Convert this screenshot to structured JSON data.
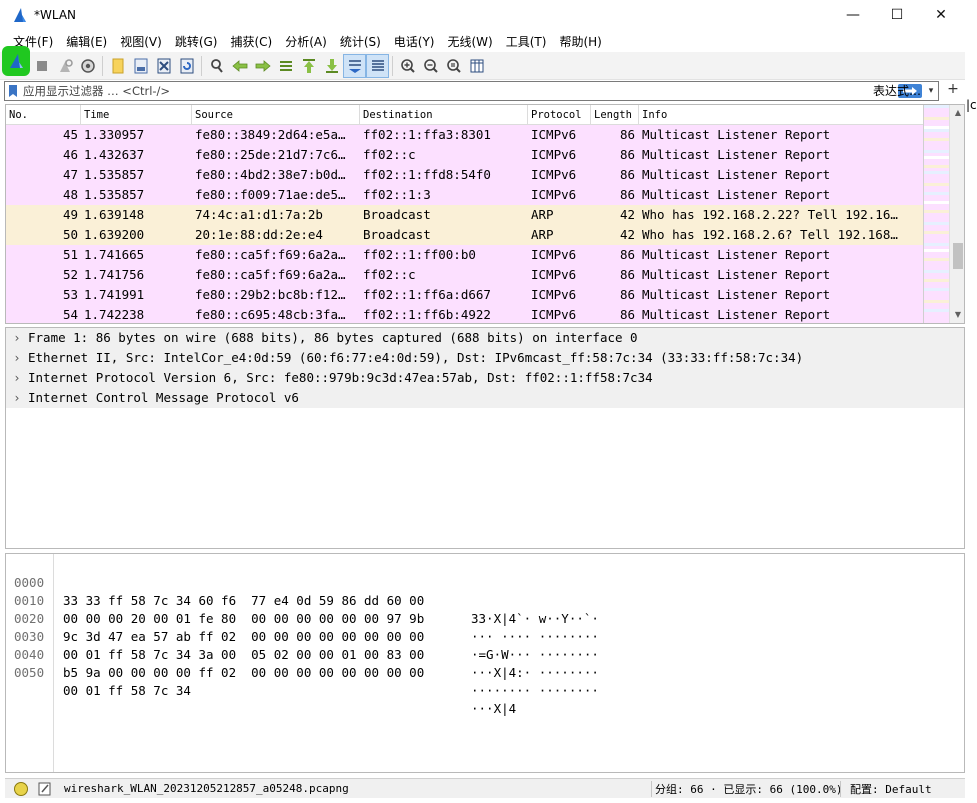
{
  "window": {
    "title": "*WLAN",
    "min_glyph": "—",
    "max_glyph": "☐",
    "close_glyph": "✕"
  },
  "menu": [
    "文件(F)",
    "编辑(E)",
    "视图(V)",
    "跳转(G)",
    "捕获(C)",
    "分析(A)",
    "统计(S)",
    "电话(Y)",
    "无线(W)",
    "工具(T)",
    "帮助(H)"
  ],
  "toolbar": {
    "buttons": [
      "start-capture-icon",
      "stop-capture-icon",
      "restart-capture-icon",
      "capture-options-icon",
      "open-file-icon",
      "save-file-icon",
      "close-file-icon",
      "reload-file-icon",
      "find-packet-icon",
      "go-back-icon",
      "go-forward-icon",
      "go-to-packet-icon",
      "go-first-icon",
      "go-last-icon",
      "autoscroll-icon",
      "colorize-icon",
      "zoom-in-icon",
      "zoom-out-icon",
      "zoom-normal-icon",
      "resize-columns-icon"
    ],
    "accent": "#20c820"
  },
  "filter": {
    "placeholder": "应用显示过滤器 … <Ctrl-/>",
    "expression_label": "表达式…",
    "plus": "+",
    "dropdown": "▾"
  },
  "edge_text": "|c",
  "packet_list": {
    "columns": [
      "No.",
      "Time",
      "Source",
      "Destination",
      "Protocol",
      "Length",
      "Info"
    ],
    "rows": [
      {
        "no": "45",
        "time": "1.330957",
        "src": "fe80::3849:2d64:e5a…",
        "dst": "ff02::1:ffa3:8301",
        "proto": "ICMPv6",
        "len": "86",
        "info": "Multicast Listener Report",
        "kind": "icmp"
      },
      {
        "no": "46",
        "time": "1.432637",
        "src": "fe80::25de:21d7:7c6…",
        "dst": "ff02::c",
        "proto": "ICMPv6",
        "len": "86",
        "info": "Multicast Listener Report",
        "kind": "icmp"
      },
      {
        "no": "47",
        "time": "1.535857",
        "src": "fe80::4bd2:38e7:b0d…",
        "dst": "ff02::1:ffd8:54f0",
        "proto": "ICMPv6",
        "len": "86",
        "info": "Multicast Listener Report",
        "kind": "icmp"
      },
      {
        "no": "48",
        "time": "1.535857",
        "src": "fe80::f009:71ae:de5…",
        "dst": "ff02::1:3",
        "proto": "ICMPv6",
        "len": "86",
        "info": "Multicast Listener Report",
        "kind": "icmp"
      },
      {
        "no": "49",
        "time": "1.639148",
        "src": "74:4c:a1:d1:7a:2b",
        "dst": "Broadcast",
        "proto": "ARP",
        "len": "42",
        "info": "Who has 192.168.2.22? Tell 192.16…",
        "kind": "arp"
      },
      {
        "no": "50",
        "time": "1.639200",
        "src": "20:1e:88:dd:2e:e4",
        "dst": "Broadcast",
        "proto": "ARP",
        "len": "42",
        "info": "Who has 192.168.2.6? Tell 192.168…",
        "kind": "arp"
      },
      {
        "no": "51",
        "time": "1.741665",
        "src": "fe80::ca5f:f69:6a2a…",
        "dst": "ff02::1:ff00:b0",
        "proto": "ICMPv6",
        "len": "86",
        "info": "Multicast Listener Report",
        "kind": "icmp"
      },
      {
        "no": "52",
        "time": "1.741756",
        "src": "fe80::ca5f:f69:6a2a…",
        "dst": "ff02::c",
        "proto": "ICMPv6",
        "len": "86",
        "info": "Multicast Listener Report",
        "kind": "icmp"
      },
      {
        "no": "53",
        "time": "1.741991",
        "src": "fe80::29b2:bc8b:f12…",
        "dst": "ff02::1:ff6a:d667",
        "proto": "ICMPv6",
        "len": "86",
        "info": "Multicast Listener Report",
        "kind": "icmp"
      },
      {
        "no": "54",
        "time": "1.742238",
        "src": "fe80::c695:48cb:3fa…",
        "dst": "ff02::1:ff6b:4922",
        "proto": "ICMPv6",
        "len": "86",
        "info": "Multicast Listener Report",
        "kind": "icmp"
      }
    ],
    "colors": {
      "icmp": "#fce0ff",
      "arp": "#faf0d7"
    }
  },
  "details": [
    "Frame 1: 86 bytes on wire (688 bits), 86 bytes captured (688 bits) on interface 0",
    "Ethernet II, Src: IntelCor_e4:0d:59 (60:f6:77:e4:0d:59), Dst: IPv6mcast_ff:58:7c:34 (33:33:ff:58:7c:34)",
    "Internet Protocol Version 6, Src: fe80::979b:9c3d:47ea:57ab, Dst: ff02::1:ff58:7c34",
    "Internet Control Message Protocol v6"
  ],
  "bytes": [
    {
      "offset": "0000",
      "hex": "33 33 ff 58 7c 34 60 f6  77 e4 0d 59 86 dd 60 00",
      "ascii": "33·X|4`· w··Y··`·"
    },
    {
      "offset": "0010",
      "hex": "00 00 00 20 00 01 fe 80  00 00 00 00 00 00 97 9b",
      "ascii": "··· ···· ········"
    },
    {
      "offset": "0020",
      "hex": "9c 3d 47 ea 57 ab ff 02  00 00 00 00 00 00 00 00",
      "ascii": "·=G·W··· ········"
    },
    {
      "offset": "0030",
      "hex": "00 01 ff 58 7c 34 3a 00  05 02 00 00 01 00 83 00",
      "ascii": "···X|4:· ········"
    },
    {
      "offset": "0040",
      "hex": "b5 9a 00 00 00 00 ff 02  00 00 00 00 00 00 00 00",
      "ascii": "········ ········"
    },
    {
      "offset": "0050",
      "hex": "00 01 ff 58 7c 34",
      "ascii": "···X|4"
    }
  ],
  "status": {
    "file": "wireshark_WLAN_20231205212857_a05248.pcapng",
    "counts": "分组: 66 · 已显示: 66 (100.0%)",
    "profile": "配置: Default"
  }
}
